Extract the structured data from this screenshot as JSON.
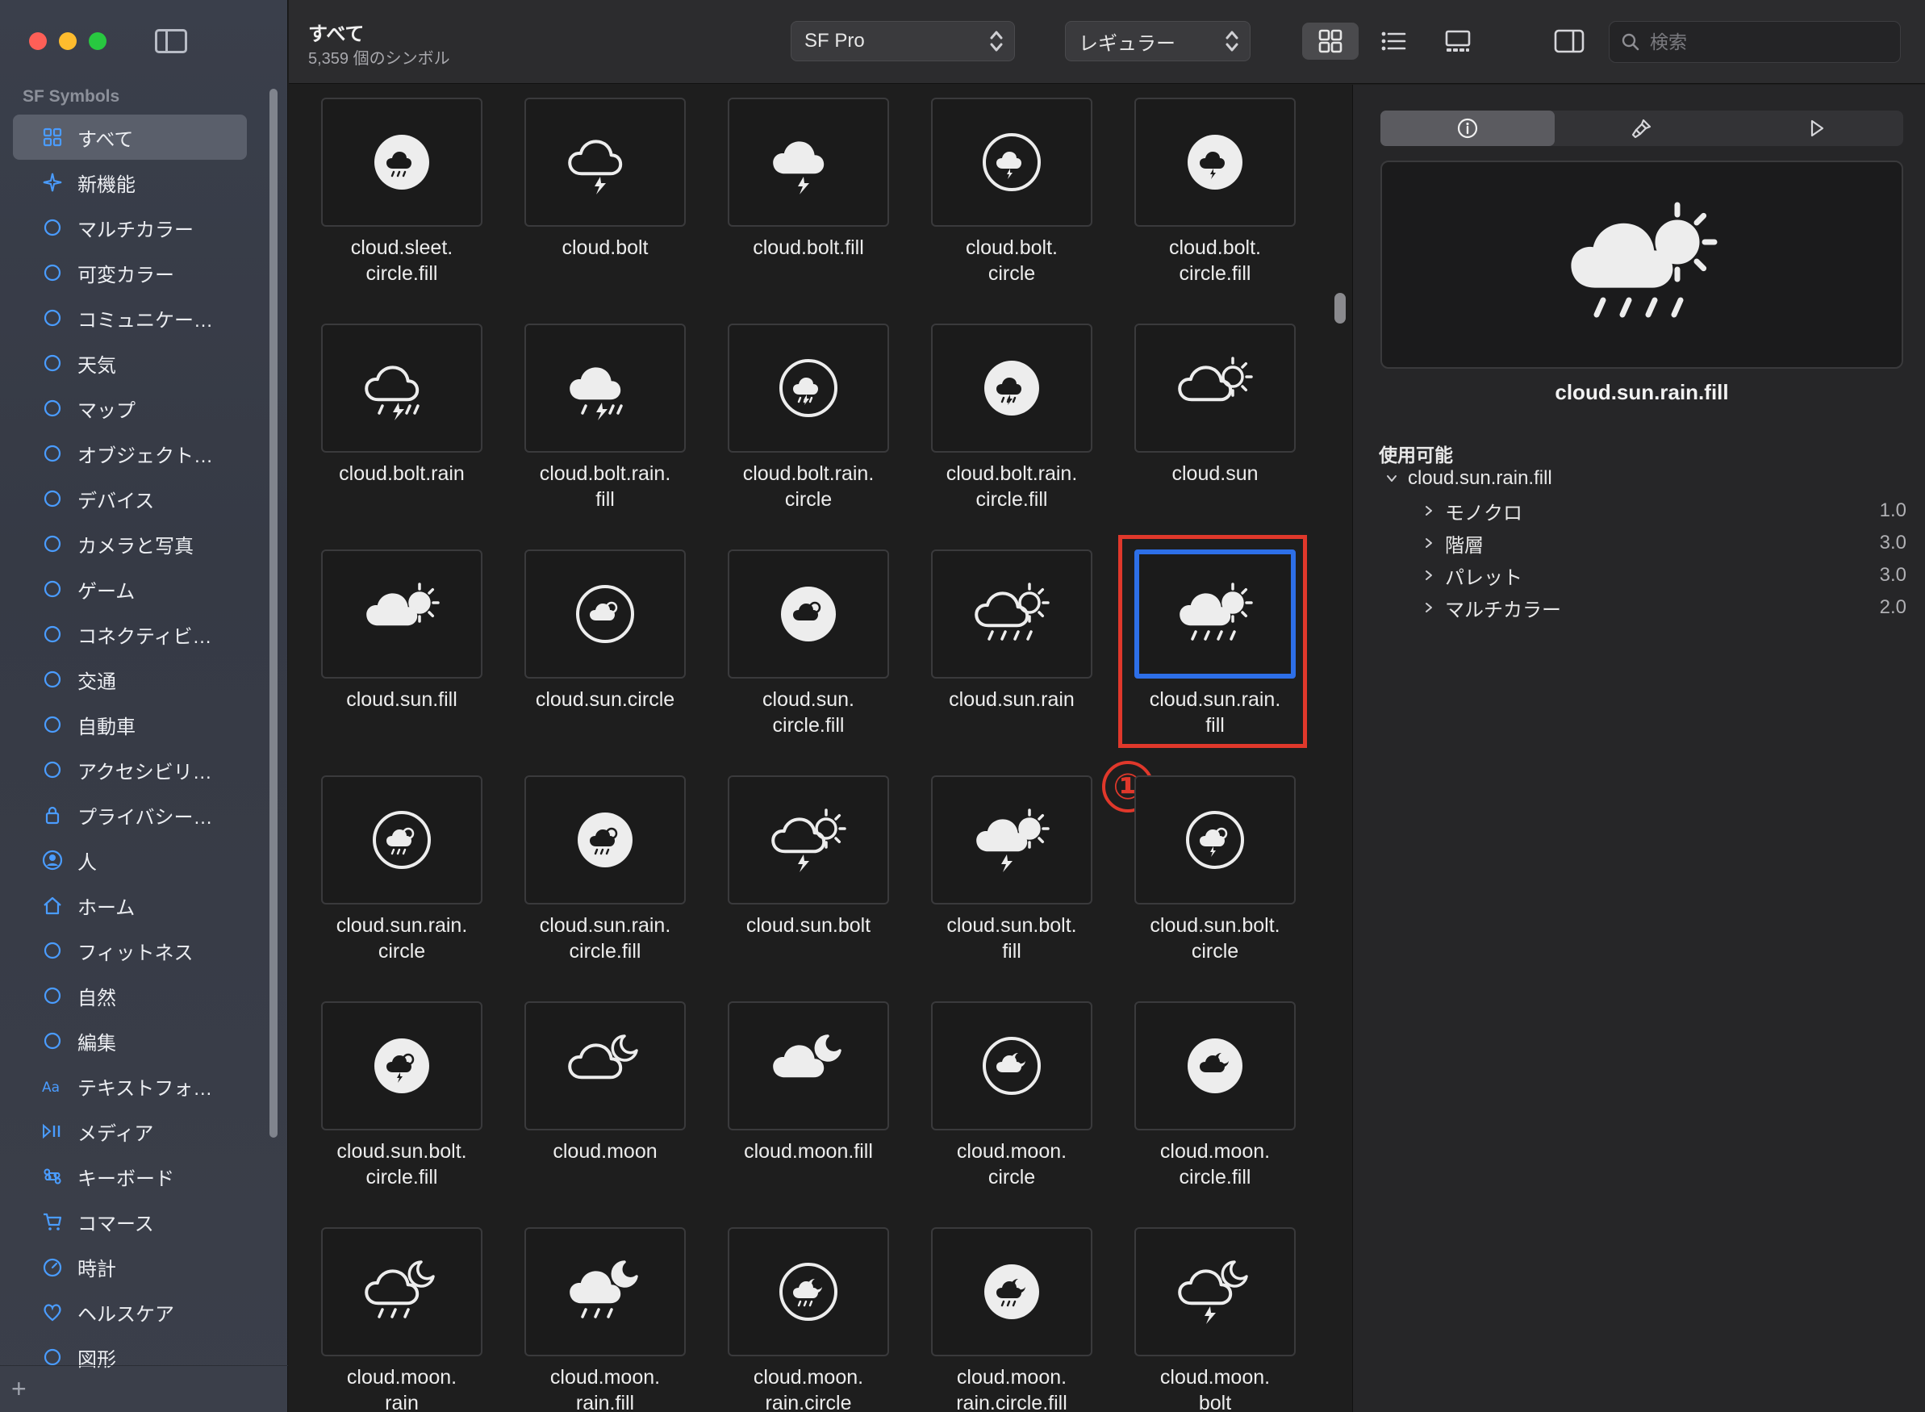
{
  "sidebar": {
    "section_title": "SF Symbols",
    "items": [
      {
        "label": "すべて",
        "icon": "grid-icon"
      },
      {
        "label": "新機能",
        "icon": "sparkle-icon"
      },
      {
        "label": "マルチカラー",
        "icon": "palette-icon"
      },
      {
        "label": "可変カラー",
        "icon": "variable-color-icon"
      },
      {
        "label": "コミュニケー…",
        "icon": "message-bubble-icon"
      },
      {
        "label": "天気",
        "icon": "cloud-sun-icon"
      },
      {
        "label": "マップ",
        "icon": "map-icon"
      },
      {
        "label": "オブジェクト…",
        "icon": "folder-icon"
      },
      {
        "label": "デバイス",
        "icon": "display-icon"
      },
      {
        "label": "カメラと写真",
        "icon": "camera-icon"
      },
      {
        "label": "ゲーム",
        "icon": "gamecontroller-icon"
      },
      {
        "label": "コネクティビ…",
        "icon": "antenna-icon"
      },
      {
        "label": "交通",
        "icon": "car-icon"
      },
      {
        "label": "自動車",
        "icon": "steering-wheel-icon"
      },
      {
        "label": "アクセシビリ…",
        "icon": "accessibility-icon"
      },
      {
        "label": "プライバシー…",
        "icon": "lock-icon"
      },
      {
        "label": "人",
        "icon": "person-icon"
      },
      {
        "label": "ホーム",
        "icon": "house-icon"
      },
      {
        "label": "フィットネス",
        "icon": "figure-run-icon"
      },
      {
        "label": "自然",
        "icon": "leaf-icon"
      },
      {
        "label": "編集",
        "icon": "slider-icon"
      },
      {
        "label": "テキストフォ…",
        "icon": "textformat-icon"
      },
      {
        "label": "メディア",
        "icon": "playpause-icon"
      },
      {
        "label": "キーボード",
        "icon": "command-icon"
      },
      {
        "label": "コマース",
        "icon": "cart-icon"
      },
      {
        "label": "時計",
        "icon": "timer-icon"
      },
      {
        "label": "ヘルスケア",
        "icon": "heart-icon"
      },
      {
        "label": "図形",
        "icon": "shapes-icon"
      }
    ],
    "add_label": "+"
  },
  "toolbar": {
    "title": "すべて",
    "subtitle": "5,359 個のシンボル",
    "font_popup": "SF Pro",
    "weight_popup": "レギュラー",
    "search_placeholder": "検索"
  },
  "grid": {
    "symbols": [
      {
        "name": "cloud.sleet.\ncircle.fill",
        "icon": "cloud-sleet-circle-fill-icon"
      },
      {
        "name": "cloud.bolt",
        "icon": "cloud-bolt-icon"
      },
      {
        "name": "cloud.bolt.fill",
        "icon": "cloud-bolt-fill-icon"
      },
      {
        "name": "cloud.bolt.\ncircle",
        "icon": "cloud-bolt-circle-icon"
      },
      {
        "name": "cloud.bolt.\ncircle.fill",
        "icon": "cloud-bolt-circle-fill-icon"
      },
      {
        "name": "cloud.bolt.rain",
        "icon": "cloud-bolt-rain-icon"
      },
      {
        "name": "cloud.bolt.rain.\nfill",
        "icon": "cloud-bolt-rain-fill-icon"
      },
      {
        "name": "cloud.bolt.rain.\ncircle",
        "icon": "cloud-bolt-rain-circle-icon"
      },
      {
        "name": "cloud.bolt.rain.\ncircle.fill",
        "icon": "cloud-bolt-rain-circle-fill-icon"
      },
      {
        "name": "cloud.sun",
        "icon": "cloud-sun-icon"
      },
      {
        "name": "cloud.sun.fill",
        "icon": "cloud-sun-fill-icon"
      },
      {
        "name": "cloud.sun.circle",
        "icon": "cloud-sun-circle-icon"
      },
      {
        "name": "cloud.sun.\ncircle.fill",
        "icon": "cloud-sun-circle-fill-icon"
      },
      {
        "name": "cloud.sun.rain",
        "icon": "cloud-sun-rain-icon"
      },
      {
        "name": "cloud.sun.rain.\nfill",
        "icon": "cloud-sun-rain-fill-icon",
        "selected": true
      },
      {
        "name": "cloud.sun.rain.\ncircle",
        "icon": "cloud-sun-rain-circle-icon"
      },
      {
        "name": "cloud.sun.rain.\ncircle.fill",
        "icon": "cloud-sun-rain-circle-fill-icon"
      },
      {
        "name": "cloud.sun.bolt",
        "icon": "cloud-sun-bolt-icon"
      },
      {
        "name": "cloud.sun.bolt.\nfill",
        "icon": "cloud-sun-bolt-fill-icon"
      },
      {
        "name": "cloud.sun.bolt.\ncircle",
        "icon": "cloud-sun-bolt-circle-icon"
      },
      {
        "name": "cloud.sun.bolt.\ncircle.fill",
        "icon": "cloud-sun-bolt-circle-fill-icon"
      },
      {
        "name": "cloud.moon",
        "icon": "cloud-moon-icon"
      },
      {
        "name": "cloud.moon.fill",
        "icon": "cloud-moon-fill-icon"
      },
      {
        "name": "cloud.moon.\ncircle",
        "icon": "cloud-moon-circle-icon"
      },
      {
        "name": "cloud.moon.\ncircle.fill",
        "icon": "cloud-moon-circle-fill-icon"
      },
      {
        "name": "cloud.moon.\nrain",
        "icon": "cloud-moon-rain-icon"
      },
      {
        "name": "cloud.moon.\nrain.fill",
        "icon": "cloud-moon-rain-fill-icon"
      },
      {
        "name": "cloud.moon.\nrain.circle",
        "icon": "cloud-moon-rain-circle-icon"
      },
      {
        "name": "cloud.moon.\nrain.circle.fill",
        "icon": "cloud-moon-rain-circle-fill-icon"
      },
      {
        "name": "cloud.moon.\nbolt",
        "icon": "cloud-moon-bolt-icon"
      }
    ],
    "annotation_number": "①"
  },
  "inspector": {
    "tabs": [
      {
        "icon": "info-circle-icon"
      },
      {
        "icon": "paintbrush-icon"
      },
      {
        "icon": "play-icon"
      }
    ],
    "preview_name": "cloud.sun.rain.fill",
    "availability_title": "使用可能",
    "availability_root": "cloud.sun.rain.fill",
    "availability": [
      {
        "label": "モノクロ",
        "version": "1.0"
      },
      {
        "label": "階層",
        "version": "3.0"
      },
      {
        "label": "パレット",
        "version": "3.0"
      },
      {
        "label": "マルチカラー",
        "version": "2.0"
      }
    ]
  },
  "colors": {
    "accent_blue": "#2d6fe8",
    "annotation_red": "#e0382b",
    "sidebar_icon_blue": "#4a9cff"
  }
}
